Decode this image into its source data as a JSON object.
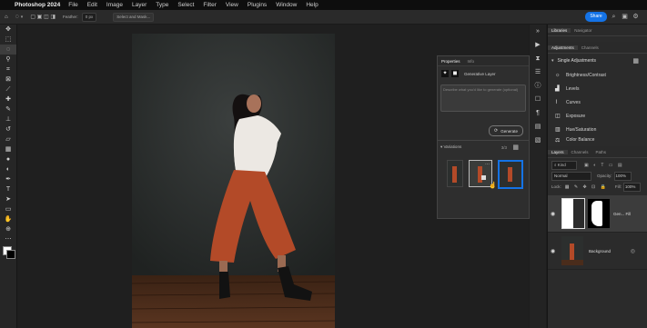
{
  "menu": {
    "app_name": "Photoshop 2024",
    "items": [
      "File",
      "Edit",
      "Image",
      "Layer",
      "Type",
      "Select",
      "Filter",
      "View",
      "Plugins",
      "Window",
      "Help"
    ]
  },
  "options": {
    "feather_label": "Feather:",
    "feather_value": "0 px",
    "select_mask_label": "Select and Mask...",
    "share_label": "Share"
  },
  "toolbar": {
    "tools": [
      "move-icon",
      "artboard-icon",
      "lasso-icon",
      "object-select-icon",
      "crop-icon",
      "frame-icon",
      "eyedropper-icon",
      "spot-heal-icon",
      "brush-icon",
      "stamp-icon",
      "history-brush-icon",
      "eraser-icon",
      "gradient-icon",
      "blur-icon",
      "dodge-icon",
      "pen-icon",
      "type-icon",
      "path-select-icon",
      "rectangle-icon",
      "hand-icon",
      "zoom-icon",
      "more-icon"
    ]
  },
  "properties": {
    "tabs": [
      "Properties",
      "Info"
    ],
    "layer_type": "Generative Layer",
    "prompt_placeholder": "Describe what you'd like to generate (optional)",
    "generate_label": "Generate",
    "variations_label": "Variations",
    "variations_count": "3/3"
  },
  "right": {
    "top_tabs": [
      "Libraries",
      "Navigator"
    ],
    "adj_tabs": [
      "Adjustments",
      "Channels"
    ],
    "adj_header": "Single Adjustments",
    "adjustments": [
      "Brightness/Contrast",
      "Levels",
      "Curves",
      "Exposure",
      "Hue/Saturation",
      "Color Balance"
    ],
    "layers_tabs": [
      "Layers",
      "Channels",
      "Paths"
    ],
    "kind_label": "Kind",
    "blend_mode": "Normal",
    "opacity_label": "Opacity:",
    "opacity_value": "100%",
    "lock_label": "Lock:",
    "fill_label": "Fill:",
    "fill_value": "100%",
    "layers": [
      {
        "name": "Gen... Fill",
        "has_mask": true
      },
      {
        "name": "Background",
        "has_mask": false
      }
    ]
  },
  "colors": {
    "accent": "#1473e6",
    "wall": "#2c2f2e",
    "floor": "#4a2c1b",
    "pants": "#b34a28",
    "shirt": "#e8e4df"
  }
}
